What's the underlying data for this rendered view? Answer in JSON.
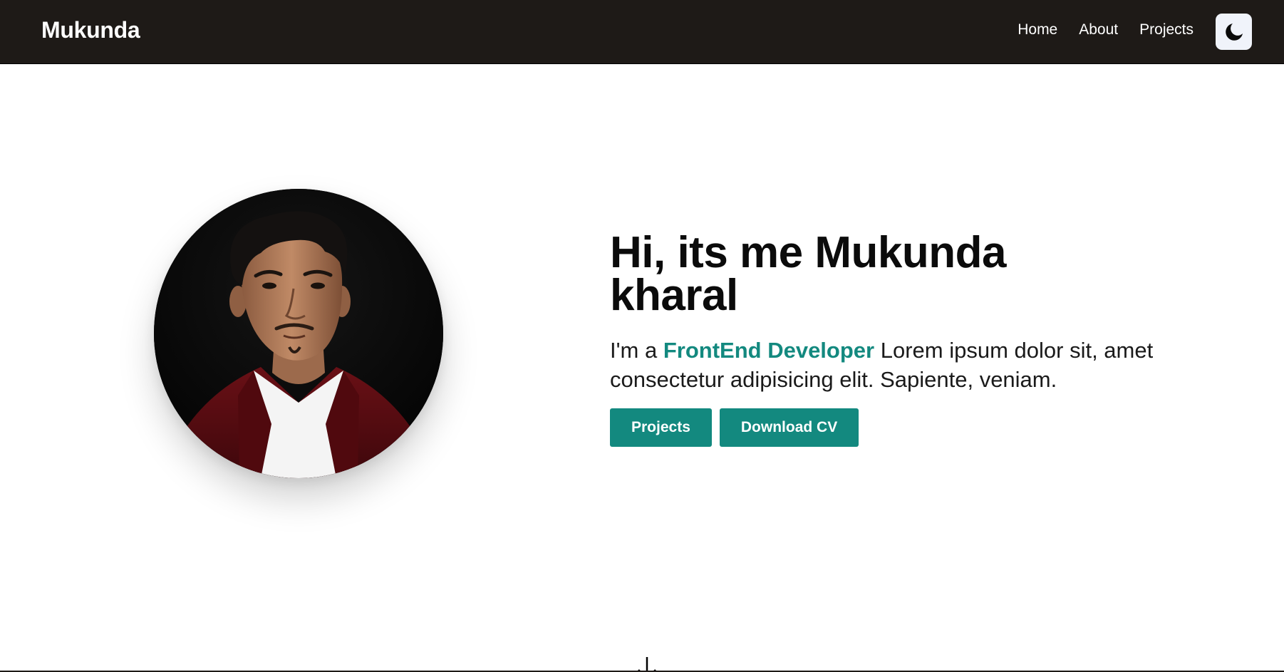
{
  "navbar": {
    "brand": "Mukunda",
    "links": [
      {
        "label": "Home"
      },
      {
        "label": "About"
      },
      {
        "label": "Projects"
      }
    ],
    "theme_toggle_icon": "moon-icon"
  },
  "hero": {
    "photo_icon": "profile-photo",
    "title_line1": "Hi, its me Mukunda",
    "title_line2": "kharal",
    "desc_prefix": "I'm a",
    "desc_highlight": "FrontEnd Developer",
    "desc_suffix": "Lorem ipsum dolor sit, amet consectetur adipisicing elit. Sapiente, veniam.",
    "buttons": {
      "projects": "Projects",
      "download_cv": "Download CV"
    }
  },
  "scroll_hint_icon": "arrow-down-icon",
  "colors": {
    "navbar_bg": "#1e1a17",
    "accent": "#13897f",
    "toggle_bg": "#f0f3fa"
  }
}
